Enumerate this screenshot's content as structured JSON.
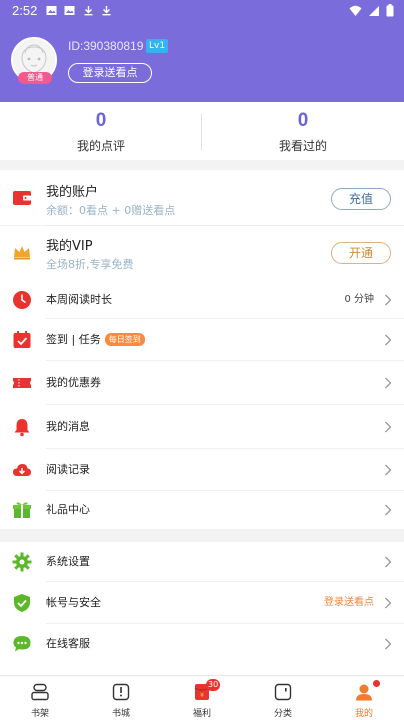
{
  "status_bar": {
    "time": "2:52"
  },
  "profile": {
    "user_id": "ID:390380819",
    "level": "Lv1",
    "avatar_badge": "普通",
    "login_button": "登录送看点"
  },
  "stats": [
    {
      "value": "0",
      "label": "我的点评"
    },
    {
      "value": "0",
      "label": "我看过的"
    }
  ],
  "account": {
    "title": "我的账户",
    "balance": "余额：0看点 + 0赠送看点",
    "button": "充值"
  },
  "vip": {
    "title": "我的VIP",
    "desc": "全场8折,专享免费",
    "button": "开通"
  },
  "menu_group_1": [
    {
      "label": "本周阅读时长",
      "value": "0 分钟"
    },
    {
      "label": "签到 | 任务",
      "tag": "每日签到"
    },
    {
      "label": "我的优惠券"
    },
    {
      "label": "我的消息"
    },
    {
      "label": "阅读记录"
    },
    {
      "label": "礼品中心"
    }
  ],
  "menu_group_2": [
    {
      "label": "系统设置"
    },
    {
      "label": "帐号与安全",
      "value": "登录送看点"
    },
    {
      "label": "在线客服"
    }
  ],
  "bottom_nav": [
    {
      "label": "书架"
    },
    {
      "label": "书城"
    },
    {
      "label": "福利",
      "badge": "30"
    },
    {
      "label": "分类"
    },
    {
      "label": "我的"
    }
  ],
  "colors": {
    "header": "#7b6cdc",
    "accent": "#6c63d8",
    "active_tab": "#f57a2b"
  }
}
